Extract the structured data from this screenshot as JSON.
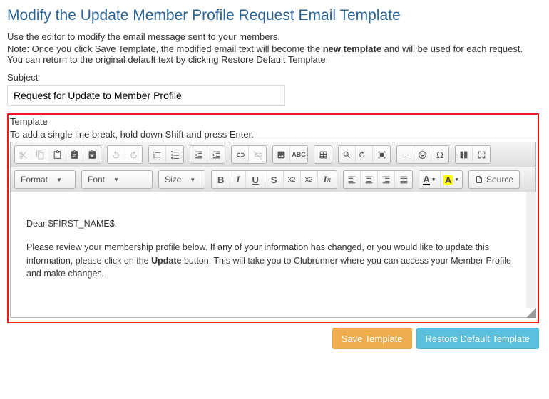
{
  "page": {
    "title": "Modify the Update Member Profile Request Email Template",
    "intro_line1": "Use the editor to modify the email message sent to your members.",
    "intro_line2a": "Note: Once you click Save Template, the modified email text will become the ",
    "intro_line2_bold": "new template",
    "intro_line2b": " and will be used for each request. You can return to the original default text by clicking Restore Default Template.",
    "subject_label": "Subject",
    "subject_value": "Request for Update to Member Profile",
    "template_label": "Template",
    "template_hint": "To add a single line break, hold down Shift and press Enter."
  },
  "toolbar": {
    "dropdowns": {
      "format": "Format",
      "font": "Font",
      "size": "Size"
    },
    "styles": {
      "bold": "B",
      "italic": "I",
      "underline": "U",
      "strike": "S",
      "subscript": "x₂",
      "superscript": "x²",
      "removeformat": "Tₓ"
    },
    "textcolor": "A",
    "bgcolor": "A",
    "source_label": "Source"
  },
  "editor": {
    "greeting": "Dear $FIRST_NAME$,",
    "body_before": "Please review your membership profile below. If any of your information has changed, or you would like to update this information, please click on the ",
    "body_bold": "Update",
    "body_after": " button. This will take you to Clubrunner where you can access your Member Profile and make changes."
  },
  "actions": {
    "save": "Save Template",
    "restore": "Restore Default Template"
  }
}
